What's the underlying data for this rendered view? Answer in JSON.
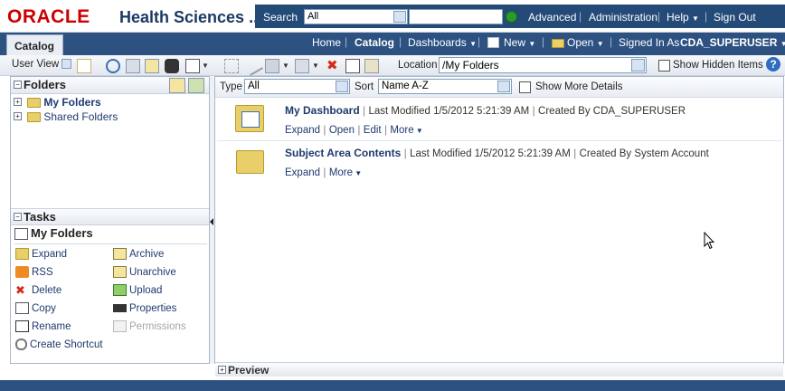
{
  "brand": {
    "logo": "ORACLE",
    "app_name": "Health Sciences ...",
    "logo_color": "#cc0000"
  },
  "topnav": {
    "search_label": "Search",
    "search_scope": "All",
    "advanced": "Advanced",
    "administration": "Administration",
    "help": "Help",
    "sign_out": "Sign Out"
  },
  "subnav": {
    "tab": "Catalog",
    "home": "Home",
    "catalog": "Catalog",
    "dashboards": "Dashboards",
    "new": "New",
    "open": "Open",
    "signed_in_label": "Signed In As",
    "user": "CDA_SUPERUSER"
  },
  "toolbar": {
    "user_view": "User View",
    "location_label": "Location",
    "location_value": "/My Folders",
    "show_hidden": "Show Hidden Items"
  },
  "folders": {
    "title": "Folders",
    "items": [
      "My Folders",
      "Shared Folders"
    ]
  },
  "tasks": {
    "title": "Tasks",
    "context": "My Folders",
    "left": [
      "Expand",
      "RSS",
      "Delete",
      "Copy",
      "Rename",
      "Create Shortcut"
    ],
    "right": [
      "Archive",
      "Unarchive",
      "Upload",
      "Properties",
      "Permissions"
    ]
  },
  "filter": {
    "type_label": "Type",
    "type_value": "All",
    "sort_label": "Sort",
    "sort_value": "Name A-Z",
    "show_more": "Show More Details"
  },
  "items": [
    {
      "title": "My Dashboard",
      "modified": "Last Modified 1/5/2012 5:21:39 AM",
      "created": "Created By CDA_SUPERUSER",
      "actions": [
        "Expand",
        "Open",
        "Edit",
        "More"
      ]
    },
    {
      "title": "Subject Area Contents",
      "modified": "Last Modified 1/5/2012 5:21:39 AM",
      "created": "Created By System Account",
      "actions": [
        "Expand",
        "More"
      ]
    }
  ],
  "preview": {
    "title": "Preview"
  }
}
